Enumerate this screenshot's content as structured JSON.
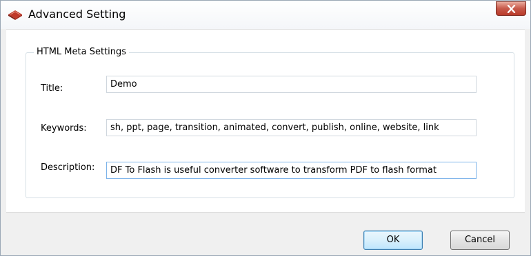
{
  "window": {
    "title": "Advanced Setting",
    "close_icon": "close-icon"
  },
  "group": {
    "legend": "HTML Meta Settings"
  },
  "fields": {
    "title": {
      "label": "Title:",
      "value": "Demo"
    },
    "keywords": {
      "label": "Keywords:",
      "value": "sh, ppt, page, transition, animated, convert, publish, online, website, link"
    },
    "description": {
      "label": "Description:",
      "value": "DF To Flash is useful converter software to transform PDF to flash format"
    }
  },
  "buttons": {
    "ok": "OK",
    "cancel": "Cancel"
  },
  "colors": {
    "close_button": "#c7594a",
    "focus_border": "#7eb4ea",
    "default_button_border": "#3c7fb1"
  }
}
